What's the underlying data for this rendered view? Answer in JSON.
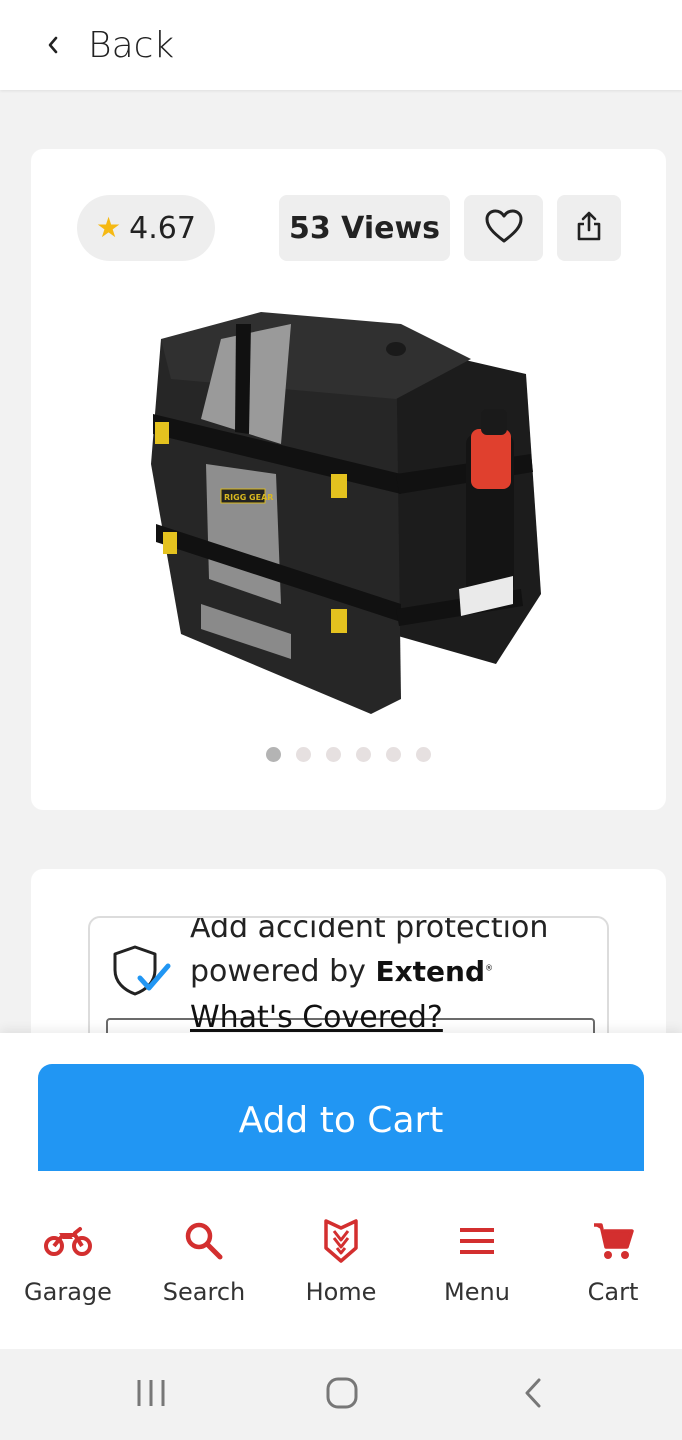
{
  "header": {
    "back_label": "Back"
  },
  "product": {
    "rating": "4.67",
    "views": "53 Views",
    "image_alt": "Nelson-Rigg black and grey waterproof saddlebag with red fuel bottle",
    "gallery_dot_count": 6,
    "gallery_active_index": 0
  },
  "protection": {
    "cut_text": "Add accident protection",
    "powered_by": "powered by",
    "brand": "Extend",
    "covered_link": "What's Covered?"
  },
  "cart": {
    "add_to_cart_label": "Add to Cart"
  },
  "bottom_nav": {
    "items": [
      {
        "label": "Garage",
        "icon": "motorcycle-icon"
      },
      {
        "label": "Search",
        "icon": "search-icon"
      },
      {
        "label": "Home",
        "icon": "home-logo-icon"
      },
      {
        "label": "Menu",
        "icon": "menu-icon"
      },
      {
        "label": "Cart",
        "icon": "cart-icon"
      }
    ]
  },
  "colors": {
    "accent_red": "#d32f2f",
    "button_blue": "#2196f3",
    "star": "#f5b914",
    "shield_check": "#2196f3"
  }
}
